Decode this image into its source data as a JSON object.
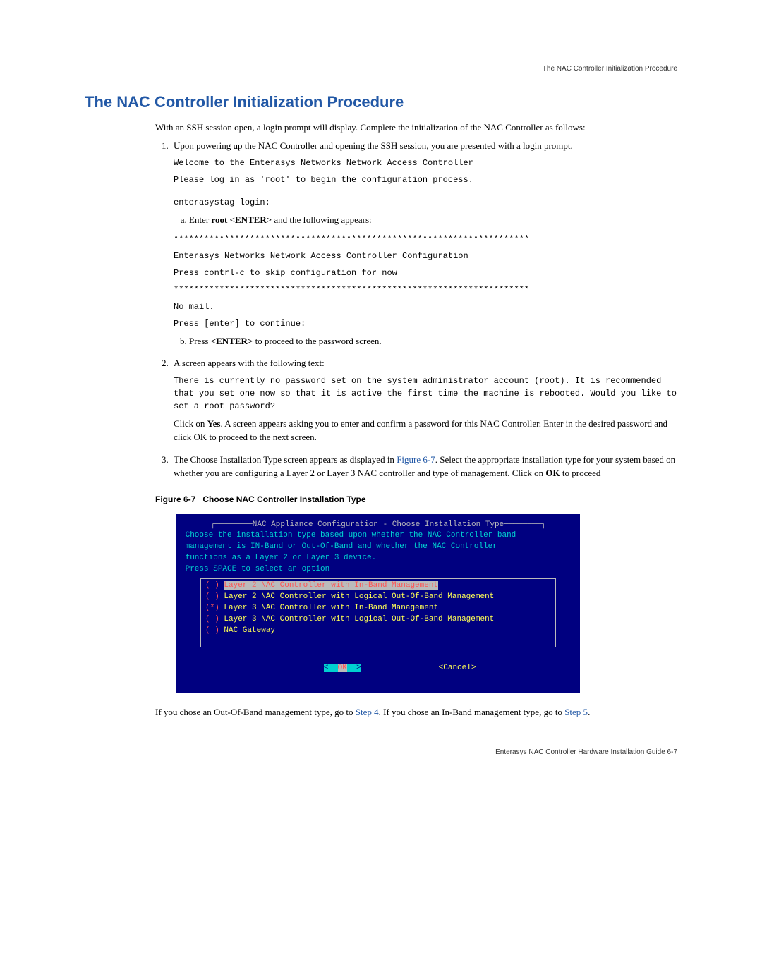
{
  "header": {
    "running_title": "The NAC Controller Initialization Procedure"
  },
  "section": {
    "title": "The NAC Controller Initialization Procedure",
    "intro": "With an SSH session open, a login prompt will display. Complete the initialization of the NAC Controller as follows:"
  },
  "step1": {
    "text": "Upon powering up the NAC Controller and opening the SSH session, you are presented with a login prompt.",
    "mono_a": "Welcome to the Enterasys Networks Network Access Controller",
    "mono_b": "Please log in as 'root' to begin the configuration process.",
    "mono_c": "enterasystag login:",
    "sub_a_before": "Enter ",
    "sub_a_bold": "root <ENTER>",
    "sub_a_after": " and the following appears:",
    "mono_d": "**********************************************************************",
    "mono_e": "Enterasys Networks Network Access Controller Configuration",
    "mono_f": "Press contrl-c to skip configuration for now",
    "mono_g": "**********************************************************************",
    "mono_h": "No mail.",
    "mono_i": "Press [enter] to continue:",
    "sub_b_before": "Press ",
    "sub_b_bold": "<ENTER>",
    "sub_b_after": " to proceed to the password screen."
  },
  "step2": {
    "text": "A screen appears with the following text:",
    "mono": "There is currently no password set on the system administrator account (root). It is recommended that you set one now so that it is active the first time the machine is rebooted. Would you like to set a root password?",
    "after_a": "Click on ",
    "after_bold": "Yes",
    "after_b": ". A screen appears asking you to enter and confirm a password for this NAC Controller. Enter in the desired password and click OK to proceed to the next screen."
  },
  "step3": {
    "before_link": "The Choose Installation Type screen appears as displayed in ",
    "link": "Figure 6-7",
    "after_link_a": ". Select the appropriate installation type for your system based on whether you are configuring a Layer 2 or Layer 3 NAC controller and type of management. Click on ",
    "after_bold": "OK",
    "after_link_b": " to proceed"
  },
  "figure": {
    "caption_num": "Figure 6-7",
    "caption_text": "Choose NAC Controller Installation Type"
  },
  "terminal": {
    "frame_title": "NAC Appliance Configuration - Choose Installation Type",
    "line1": "Choose the installation type based upon whether the NAC Controller band",
    "line2": "management is IN-Band or Out-Of-Band and whether the NAC Controller",
    "line3": "functions as a Layer 2 or Layer 3 device.",
    "line4": "Press SPACE to select an option",
    "opt1_mark": "( ) ",
    "opt1": "Layer 2 NAC Controller with In-Band Management",
    "opt2_mark": "( ) ",
    "opt2": "Layer 2 NAC Controller with Logical Out-Of-Band Management",
    "opt3_mark": "(*) ",
    "opt3": "Layer 3 NAC Controller with In-Band Management",
    "opt4_mark": "( ) ",
    "opt4": "Layer 3 NAC Controller with Logical Out-Of-Band Management",
    "opt5_mark": "( ) ",
    "opt5": "NAC Gateway",
    "btn_ok_l": "<  ",
    "btn_ok_mid": "OK",
    "btn_ok_r": "  >",
    "btn_cancel": "<Cancel>"
  },
  "post_figure": {
    "a": "If you chose an Out-Of-Band management type, go to ",
    "link1": "Step 4",
    "b": ". If you chose an In-Band management type, go to ",
    "link2": "Step 5",
    "c": "."
  },
  "footer": {
    "text": "Enterasys NAC Controller Hardware Installation Guide   6-7"
  }
}
